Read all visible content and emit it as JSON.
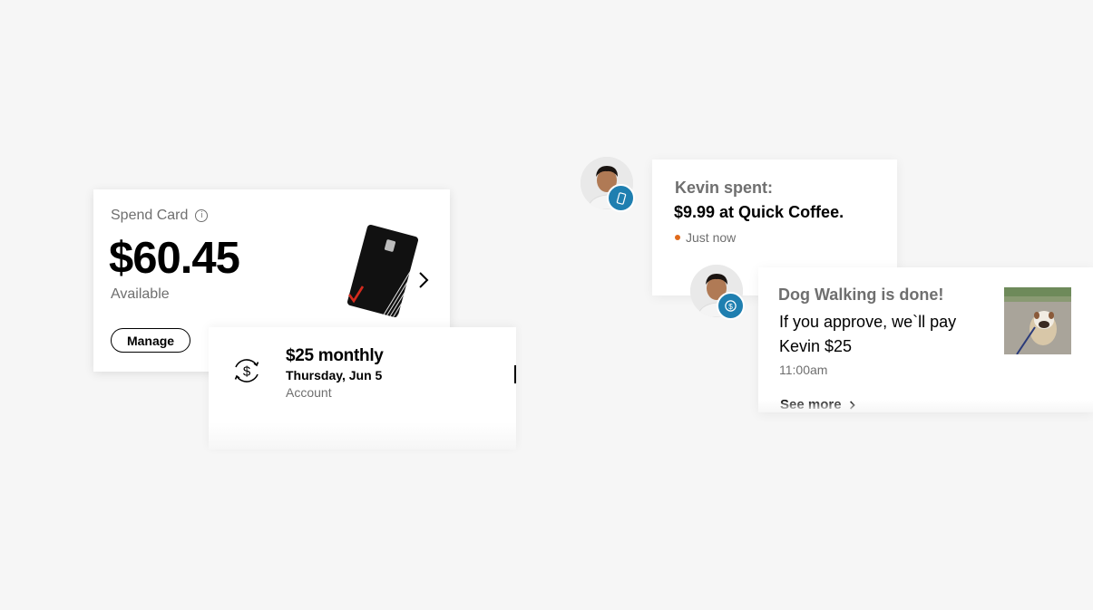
{
  "spend_card": {
    "label": "Spend Card",
    "info_icon": "info-circle-icon",
    "amount": "$60.45",
    "sublabel": "Available",
    "manage_label": "Manage",
    "chevron_icon": "chevron-right-icon"
  },
  "scheduled": {
    "icon": "recurring-dollar-icon",
    "amount": "$25 monthly",
    "date": "Thursday, Jun 5",
    "account": "Account"
  },
  "notifications": [
    {
      "badge_icon": "phone-icon",
      "title": "Kevin spent:",
      "detail": "$9.99 at Quick Coffee.",
      "time": "Just now",
      "status_color": "#e06a1b"
    },
    {
      "badge_icon": "dollar-icon",
      "title": "Dog Walking is done!",
      "body": "If you approve, we`ll pay Kevin $25",
      "time": "11:00am",
      "action": "See more"
    }
  ],
  "colors": {
    "background": "#f6f6f6",
    "badge": "#1f7fb0",
    "accent": "#e06a1b",
    "brand_check": "#d52b1e"
  }
}
